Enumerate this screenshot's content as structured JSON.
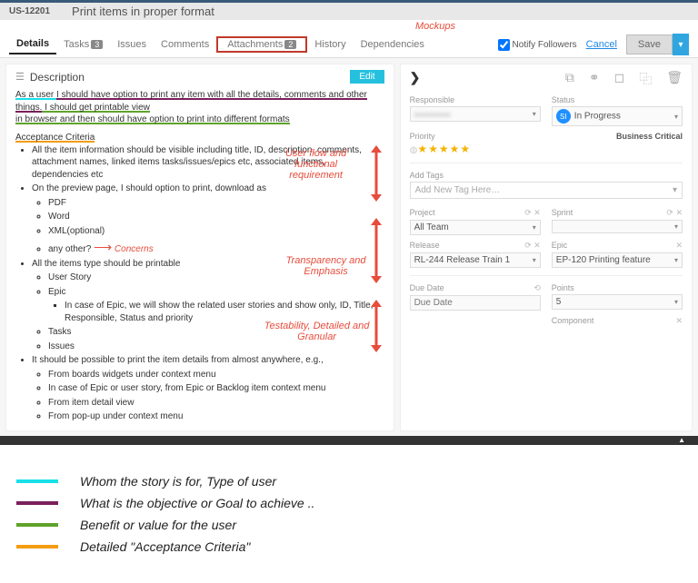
{
  "header": {
    "id": "US-12201",
    "title": "Print items in proper format",
    "mockups_label": "Mockups"
  },
  "tabs": {
    "details": "Details",
    "tasks": "Tasks",
    "tasks_badge": "3",
    "issues": "Issues",
    "comments": "Comments",
    "attachments": "Attachments",
    "attachments_badge": "2",
    "history": "History",
    "dependencies": "Dependencies"
  },
  "actions": {
    "notify": "Notify Followers",
    "cancel": "Cancel",
    "save": "Save"
  },
  "desc": {
    "heading": "Description",
    "edit": "Edit",
    "l1a": "As a user ",
    "l1b": "I should have option to print any item with all the details, comments and other things.",
    "l1c": " I should get printable view",
    "l2": "in browser and then should have option to print into different formats",
    "ac": "Acceptance Criteria",
    "b1": "All the item information should be visible including title, ID, description, comments, attachment names, linked items tasks/issues/epics etc, associated items, dependencies etc",
    "b2": "On the preview page, I should option to print, download as",
    "b2a": "PDF",
    "b2b": "Word",
    "b2c": "XML(optional)",
    "b2d": "any other?",
    "b3": "All the items type should be printable",
    "b3a": "User Story",
    "b3b": "Epic",
    "b3b1": "In case of Epic, we will show the related user stories and show only, ID, Title, Responsible, Status and priority",
    "b3c": "Tasks",
    "b3d": "Issues",
    "b4": "It should be possible to print the item details from almost anywhere, e.g.,",
    "b4a": "From boards widgets under context menu",
    "b4b": "In case of Epic or user story, from Epic or Backlog item context menu",
    "b4c": "From item detail view",
    "b4d": "From pop-up under context menu"
  },
  "ann": {
    "flow": "User flow and functional requirement",
    "concerns": "Concerns",
    "trans": "Transparency and Emphasis",
    "test": "Testability, Detailed and Granular"
  },
  "right": {
    "responsible": "Responsible",
    "status": "Status",
    "status_v": "In Progress",
    "priority": "Priority",
    "priority_v": "Business Critical",
    "addtags": "Add Tags",
    "addtag_ph": "Add New Tag Here…",
    "project": "Project",
    "project_v": "All Team",
    "sprint": "Sprint",
    "release": "Release",
    "release_v": "RL-244 Release Train 1",
    "epic": "Epic",
    "epic_v": "EP-120 Printing feature",
    "duedate": "Due Date",
    "duedate_ph": "Due Date",
    "points": "Points",
    "points_v": "5",
    "component": "Component",
    "si": "SI"
  },
  "legend": {
    "l1": "Whom the story is for, Type of user",
    "l2": "What is the objective or Goal to achieve ..",
    "l3": "Benefit or value for the user",
    "l4": "Detailed \"Acceptance Criteria\"",
    "c1": "#18e0e8",
    "c2": "#7b1f5c",
    "c3": "#5fa22a",
    "c4": "#f39c12"
  }
}
